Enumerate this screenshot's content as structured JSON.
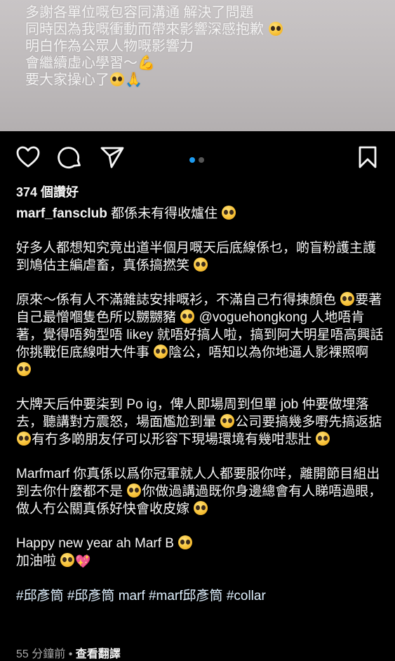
{
  "photo": {
    "lines": [
      "多謝各單位嘅包容同溝通 解決了問題",
      "同時因為我嘅衝動而帶來影響深感抱歉",
      "明白作為公眾人物嘅影響力",
      "會繼續虛心學習～",
      "要大家操心了"
    ]
  },
  "actions": {
    "like": "heart-icon",
    "comment": "comment-icon",
    "share": "send-icon",
    "save": "bookmark-icon"
  },
  "carousel": {
    "active_color": "#1d9bf0",
    "inactive_color": "#555555"
  },
  "likes": "374 個讚好",
  "caption": {
    "username": "marf_fansclub",
    "first_line": " 都係未有得收爐住",
    "p1": "好多人都想知究竟出道半個月嘅天后底線係乜，啲盲粉護主護到鳩估主編虐畜，真係搞撚笑",
    "p2a": "原來～係有人不滿雜誌安排嘅衫，不滿自己冇得揀顏色",
    "p2b": "要著自己最憎嗰隻色所以嬲嬲豬",
    "p2c": "@voguehongkong 人地唔肯著，覺得唔夠型唔 likey 就唔好搞人啦，搞到阿大明星唔高興話你挑戰佢底線咁大件事",
    "p2d": "陰公，唔知以為你地逼人影裸照啊",
    "p3a": "大牌天后仲要柒到 Po ig，俾人即場周到但單 job 仲要做埋落去，聽講對方震怒，場面尷尬到暈",
    "p3b": "公司要搞幾多嘢先搞返掂",
    "p3c": "有冇多啲朋友仔可以形容下現場環境有幾咁悲壯",
    "p4a": "Marfmarf 你真係以爲你冠軍就人人都要服你咩，離開節目組出到去你什麼都不是",
    "p4b": "你做過講過既你身邊總會有人睇唔過眼，做人冇公關真係好快會收皮嫁",
    "p5a": "Happy new year ah Marf B",
    "p5b": "加油啦",
    "hashtags": "#邱彥筒 #邱彥筒 marf #marf邱彥筒 #collar"
  },
  "meta": {
    "time": "55 分鐘前",
    "separator": " • ",
    "translate": "查看翻譯"
  }
}
